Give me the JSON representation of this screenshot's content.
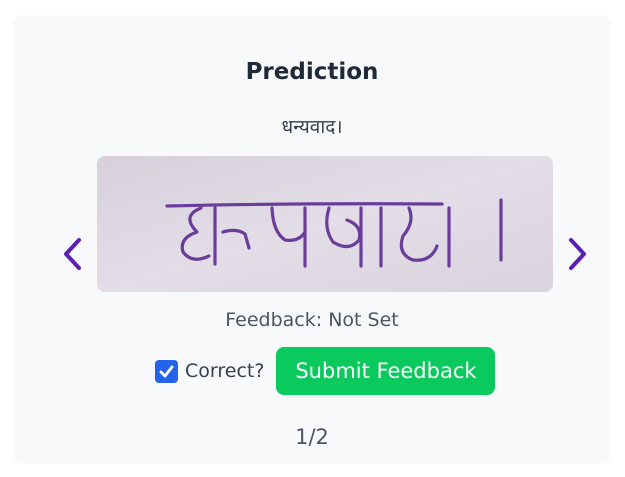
{
  "card": {
    "title": "Prediction",
    "prediction_text": "धन्यवाद।",
    "image": {
      "alt": "Handwritten Devanagari text sample",
      "handwritten_text": "धन्यवाद।"
    },
    "feedback_status": "Feedback: Not Set",
    "correct_label": "Correct?",
    "correct_checked": true,
    "submit_label": "Submit Feedback",
    "page_indicator": "1/2"
  },
  "colors": {
    "card_bg": "#f8f9fb",
    "arrow": "#5b1fb8",
    "checkbox": "#2563eb",
    "submit_bg": "#0ac95d",
    "ink": "#6a3d9a"
  },
  "icons": {
    "prev": "chevron-left-icon",
    "next": "chevron-right-icon",
    "check": "checkmark-icon"
  }
}
